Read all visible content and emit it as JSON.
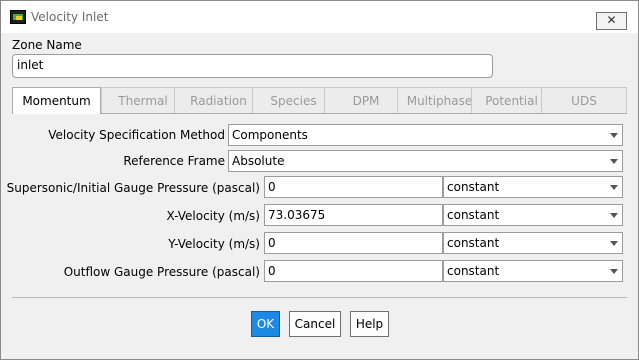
{
  "window": {
    "title": "Velocity Inlet",
    "close_glyph": "✕"
  },
  "zone": {
    "label": "Zone Name",
    "value": "inlet"
  },
  "tabs": [
    {
      "label": "Momentum",
      "active": true
    },
    {
      "label": "Thermal",
      "active": false
    },
    {
      "label": "Radiation",
      "active": false
    },
    {
      "label": "Species",
      "active": false
    },
    {
      "label": "DPM",
      "active": false
    },
    {
      "label": "Multiphase",
      "active": false
    },
    {
      "label": "Potential",
      "active": false
    },
    {
      "label": "UDS",
      "active": false
    }
  ],
  "form": {
    "velocity_spec": {
      "label": "Velocity Specification Method",
      "value": "Components"
    },
    "reference_frame": {
      "label": "Reference Frame",
      "value": "Absolute"
    },
    "supersonic_pressure": {
      "label": "Supersonic/Initial Gauge Pressure (pascal)",
      "value": "0",
      "option": "constant"
    },
    "x_velocity": {
      "label": "X-Velocity (m/s)",
      "value": "73.03675",
      "option": "constant"
    },
    "y_velocity": {
      "label": "Y-Velocity (m/s)",
      "value": "0",
      "option": "constant"
    },
    "outflow_pressure": {
      "label": "Outflow Gauge Pressure (pascal)",
      "value": "0",
      "option": "constant"
    }
  },
  "buttons": {
    "ok": "OK",
    "cancel": "Cancel",
    "help": "Help"
  },
  "colors": {
    "primary_button": "#1e88e5"
  }
}
